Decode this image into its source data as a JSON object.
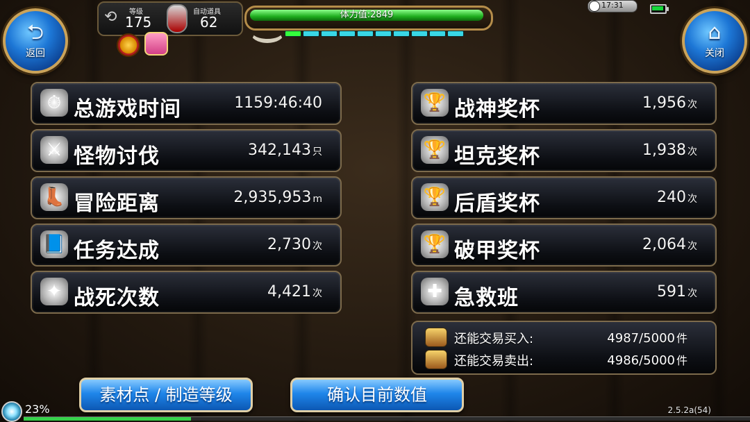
{
  "header": {
    "back_button": {
      "icon": "back-arrow-icon",
      "label": "返回"
    },
    "close_button": {
      "icon": "home-icon",
      "label": "关闭"
    },
    "level": {
      "label": "等级",
      "value": "175"
    },
    "auto_items": {
      "label": "自动道具",
      "value": "62"
    },
    "stamina": {
      "text": "体力值:2849"
    },
    "status_bar": {
      "time": "17:31"
    }
  },
  "stats_left": [
    {
      "icon": "stopwatch-icon",
      "label": "总游戏时间",
      "value": "1159:46:40",
      "unit": ""
    },
    {
      "icon": "sword-icon",
      "label": "怪物讨伐",
      "value": "342,143",
      "unit": "只"
    },
    {
      "icon": "boot-icon",
      "label": "冒险距离",
      "value": "2,935,953",
      "unit": "m"
    },
    {
      "icon": "book-icon",
      "label": "任务达成",
      "value": "2,730",
      "unit": "次"
    },
    {
      "icon": "stars-icon",
      "label": "战死次数",
      "value": "4,421",
      "unit": "次"
    }
  ],
  "stats_right": [
    {
      "icon": "trophy-icon",
      "label": "战神奖杯",
      "value": "1,956",
      "unit": "次"
    },
    {
      "icon": "trophy-icon",
      "label": "坦克奖杯",
      "value": "1,938",
      "unit": "次"
    },
    {
      "icon": "trophy-icon",
      "label": "后盾奖杯",
      "value": "240",
      "unit": "次"
    },
    {
      "icon": "trophy-icon",
      "label": "破甲奖杯",
      "value": "2,064",
      "unit": "次"
    },
    {
      "icon": "medic-icon",
      "label": "急救班",
      "value": "591",
      "unit": "次"
    }
  ],
  "trade": {
    "buy": {
      "label": "还能交易买入:",
      "value": "4987/5000",
      "unit": "件"
    },
    "sell": {
      "label": "还能交易卖出:",
      "value": "4986/5000",
      "unit": "件"
    }
  },
  "buttons": {
    "material_label": "素材点 / 制造等级",
    "confirm_label": "确认目前数值"
  },
  "footer": {
    "percent": "23%",
    "progress_fraction": 0.23,
    "version": "2.5.2a(54)"
  },
  "colors": {
    "accent_blue": "#1f86ea",
    "stamina_green": "#1fae1f",
    "panel_border_gold": "#7d6b4c"
  }
}
